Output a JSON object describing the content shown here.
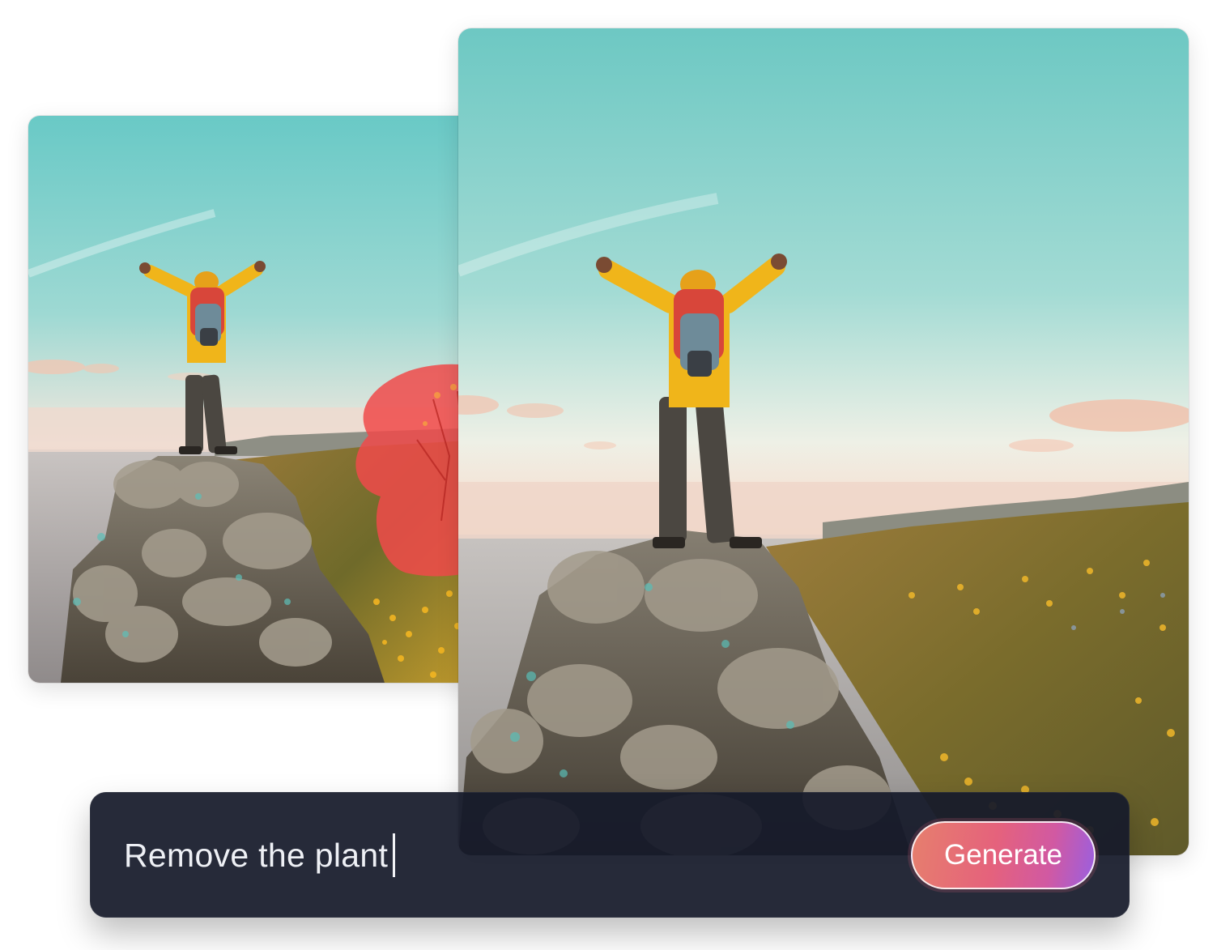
{
  "before_image": {
    "alt_icon": "landscape-photo",
    "highlight_mask_color": "#f04a4a"
  },
  "after_image": {
    "alt_icon": "landscape-photo"
  },
  "prompt": {
    "value": "Remove the plant",
    "generate_label": "Generate"
  },
  "colors": {
    "bar_background": "#161a2a",
    "button_gradient_start": "#e67f6d",
    "button_gradient_end": "#9a5fe0"
  }
}
